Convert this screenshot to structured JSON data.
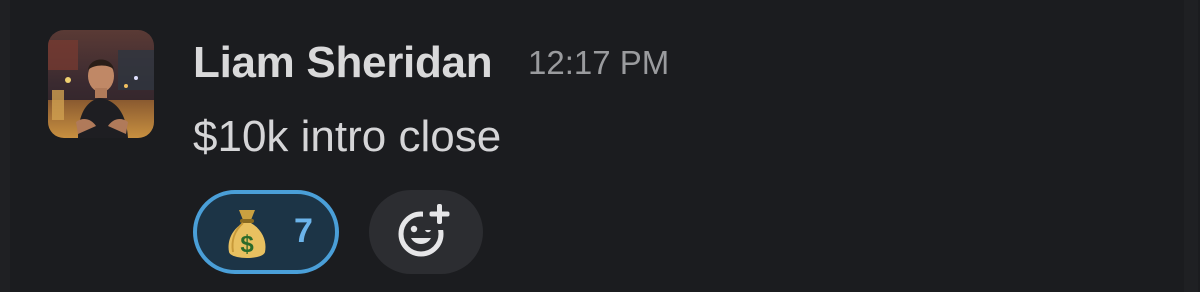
{
  "message": {
    "author": "Liam Sheridan",
    "timestamp": "12:17 PM",
    "text": "$10k intro close",
    "avatar_icon": "user-avatar-photo"
  },
  "reactions": [
    {
      "emoji": "money-bag",
      "count": "7",
      "selected": true,
      "highlight_color": "#4a9fd8"
    }
  ],
  "add_reaction": {
    "icon": "add-emoji-icon"
  }
}
